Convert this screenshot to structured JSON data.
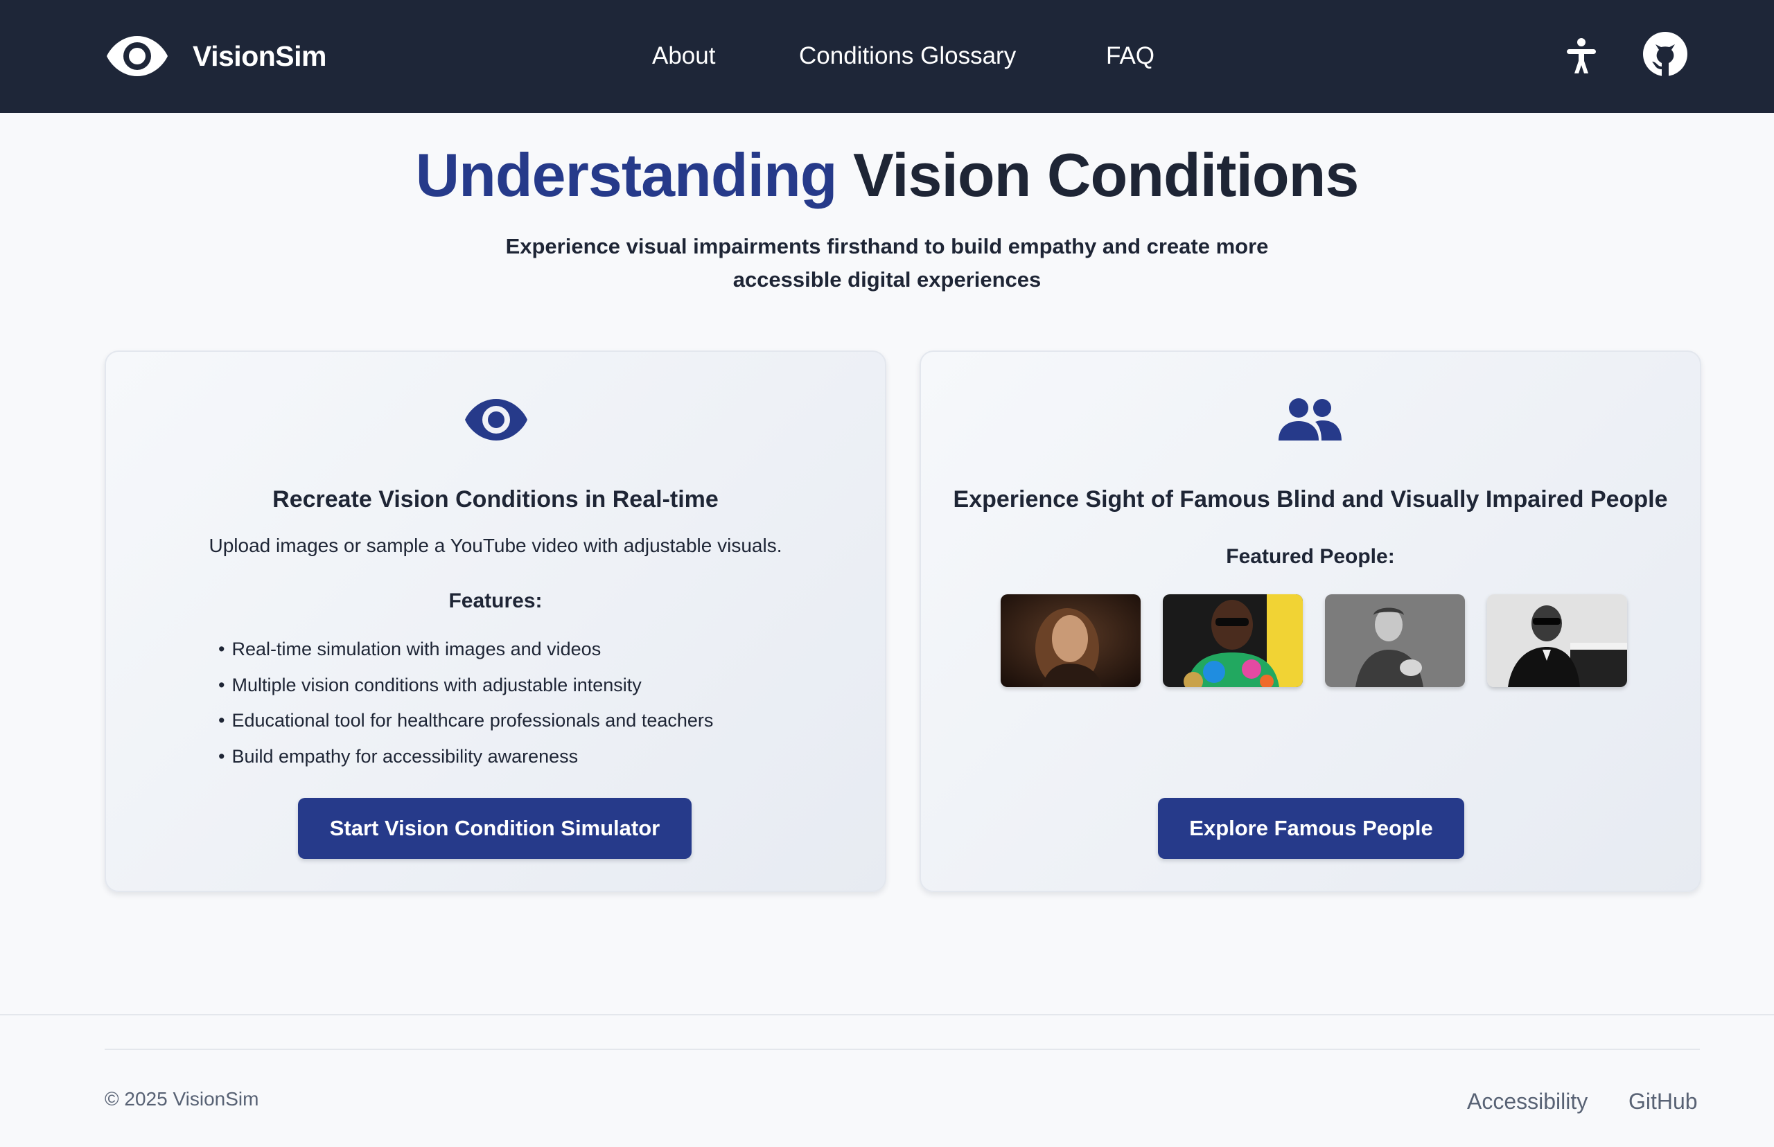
{
  "header": {
    "brand_name": "VisionSim",
    "brand_icon": "eye-icon",
    "nav": [
      {
        "label": "About"
      },
      {
        "label": "Conditions Glossary"
      },
      {
        "label": "FAQ"
      }
    ],
    "right_icons": [
      "accessibility-icon",
      "github-icon"
    ],
    "background_color": "#1e2638"
  },
  "hero": {
    "title_accent": "Understanding",
    "title_rest": "Vision Conditions",
    "subtitle": "Experience visual impairments firsthand to build empathy and create more accessible digital experiences",
    "accent_color": "#263a8a"
  },
  "cards": {
    "simulator": {
      "icon": "eye-icon",
      "title": "Recreate Vision Conditions in Real-time",
      "description": "Upload images or sample a YouTube video with adjustable visuals.",
      "features_heading": "Features:",
      "features": [
        "Real-time simulation with images and videos",
        "Multiple vision conditions with adjustable intensity",
        "Educational tool for healthcare professionals and teachers",
        "Build empathy for accessibility awareness"
      ],
      "button_label": "Start Vision Condition Simulator"
    },
    "famous": {
      "icon": "users-icon",
      "title": "Experience Sight of Famous Blind and Visually Impaired People",
      "featured_heading": "Featured People:",
      "thumbnails": [
        "portrait-painting",
        "portrait-sunglasses-colorful",
        "portrait-vintage-woman",
        "portrait-piano-sunglasses"
      ],
      "button_label": "Explore Famous People"
    }
  },
  "footer": {
    "copyright": "© 2025 VisionSim",
    "links": [
      {
        "label": "Accessibility"
      },
      {
        "label": "GitHub"
      }
    ]
  }
}
